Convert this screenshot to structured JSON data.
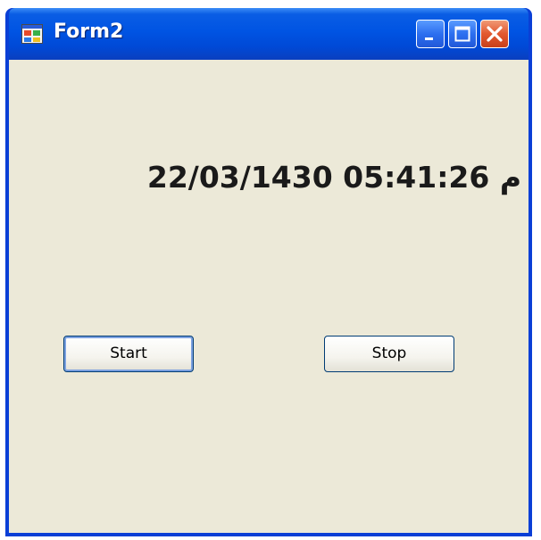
{
  "window": {
    "title": "Form2",
    "icons": {
      "app": "app-form-icon",
      "minimize": "minimize-icon",
      "maximize": "maximize-icon",
      "close": "close-icon"
    },
    "colors": {
      "titlebar": "#0054e3",
      "close_button": "#e2582f",
      "client_background": "#ece9d8"
    }
  },
  "form": {
    "clock_text": "22/03/1430 05:41:26 م",
    "start_label": "Start",
    "stop_label": "Stop"
  }
}
